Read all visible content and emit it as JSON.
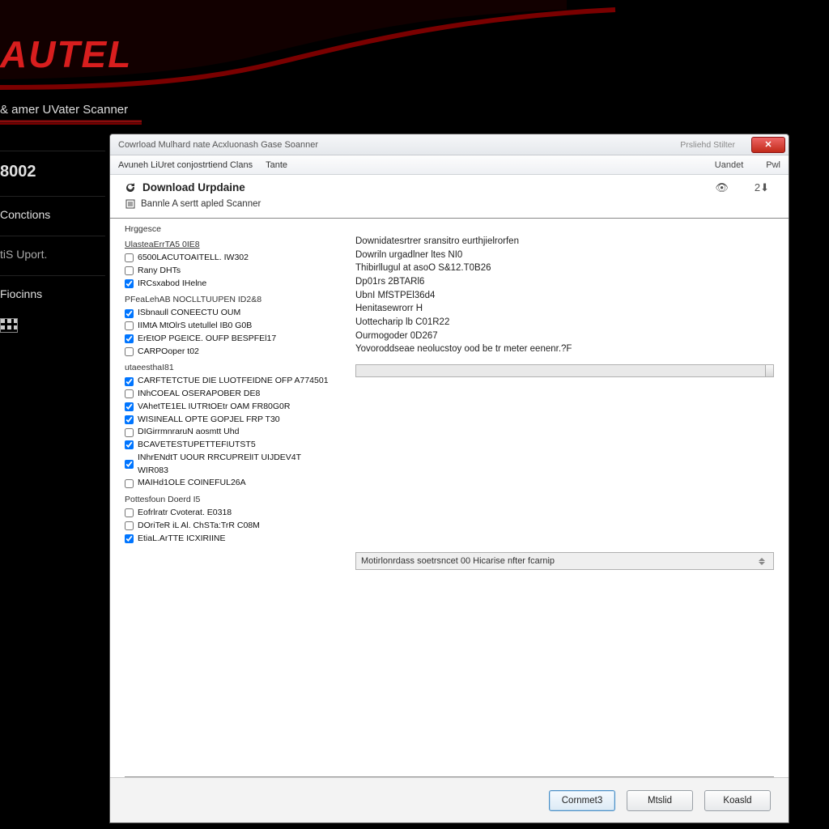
{
  "brand": {
    "logo": "AUTEL"
  },
  "sidebar": {
    "subtitle": "& amer UVater Scanner",
    "items": [
      "8002",
      "Conctions",
      "tiS Uport.",
      "Fiocinns"
    ]
  },
  "window": {
    "title": "Cowrload Mulhard nate Acxluonash Gase Soanner",
    "title_right": "Prsliehd Stilter",
    "menubar": {
      "left": [
        "Avuneh LiUret conjostrtiend Clans",
        "Tante"
      ],
      "right": [
        "Uandet",
        "Pwl"
      ]
    },
    "subheader": {
      "title": "Download Urpdaine",
      "subtitle": "Bannle A sertt apled Scanner",
      "icon_right_1": "👁",
      "icon_right_2": "2⬇"
    },
    "left_col": {
      "micro1": "Hrggesce",
      "micro2": "UlasteaErrTA5 0IE8",
      "group1": [
        {
          "label": "6500LACUTOAITELL. IW302",
          "checked": false
        },
        {
          "label": "Rany DHTs",
          "checked": false
        },
        {
          "label": "IRCsxabod IHelne",
          "checked": true
        }
      ],
      "group2_title": "PFeaLehAB NOCLLTUUPEN ID2&8",
      "group2": [
        {
          "label": "ISbnaull CONEECTU OUM",
          "checked": true
        },
        {
          "label": "IIMtA MtOlrS utetullel IB0 G0B",
          "checked": false
        },
        {
          "label": "ErEtOP PGEICE. OUFP BESPFEl17",
          "checked": true
        },
        {
          "label": "CARPOoper t02",
          "checked": false
        }
      ],
      "group3_title": "utaeesthaI81",
      "group3": [
        {
          "label": "CARFTETCTUE DIE LUOTFEIDNE OFP A774501",
          "checked": true
        },
        {
          "label": "INhCOEAL OSERAPOBER DE8",
          "checked": false
        },
        {
          "label": "VAhetTE1EL IUTRtOEtr OAM FR80G0R",
          "checked": true
        },
        {
          "label": "WISINEALL OPTE GOPJEL FRP T30",
          "checked": true
        },
        {
          "label": "DIGirrmnraruN aosmtt Uhd",
          "checked": false
        },
        {
          "label": "BCAVETESTUPETTEFIUTST5",
          "checked": true
        },
        {
          "label": "INhrENdtT UOUR RRCUPRElIT UIJDEV4T WIR083",
          "checked": true
        },
        {
          "label": "MAIHd1OLE COINEFUL26A",
          "checked": false
        }
      ],
      "group4_title": "Pottesfoun Doerd I5",
      "group4": [
        {
          "label": "Eofrlratr Cvoterat. E0318",
          "checked": false
        },
        {
          "label": "DOriTeR iL Al. ChSTa:TrR C08M",
          "checked": false
        },
        {
          "label": "EtiaL.ArTTE ICXIRIINE",
          "checked": true
        }
      ]
    },
    "log": [
      "Downidatesrtrer sransitro eurthjielrorfen",
      "Dowriln urgadlner ltes NI0",
      "Thibirllugul at asoO S&12.T0B26",
      "Dp01rs 2BTARl6",
      "UbnI MfSTPEl36d4",
      "Henitasewrorr H",
      "Uottecharip lb C01R22",
      "Ourmogoder 0D267",
      "Yovoroddseae neolucstoy ood be tr meter eenenr.?F"
    ],
    "status_text": "Motirlonrdass soetrsncet 00 Hicarise nfter fcarnip",
    "footer": {
      "primary": "Cornmet3",
      "mid": "Mtslid",
      "last": "Koasld"
    }
  }
}
